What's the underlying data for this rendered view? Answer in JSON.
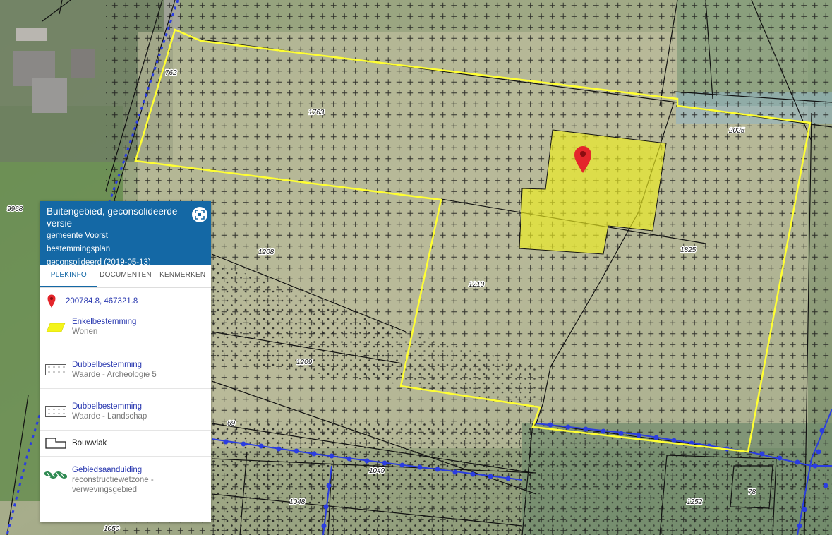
{
  "panel": {
    "title": "Buitengebied, geconsolideerde versie",
    "municipality": "gemeente Voorst",
    "plan_type": "bestemmingsplan",
    "status": "geconsolideerd (2019-05-13)",
    "fullscreen_icon": "fullscreen-icon"
  },
  "tabs": [
    {
      "label": "PLEKINFO",
      "active": true
    },
    {
      "label": "DOCUMENTEN",
      "active": false
    },
    {
      "label": "KENMERKEN",
      "active": false
    }
  ],
  "location": {
    "coordinates": "200784.8, 467321.8",
    "icon": "location-pin-icon"
  },
  "info_items": [
    {
      "title": "Enkelbestemming",
      "subtitle": "Wonen",
      "icon": "yellow-parallelogram-icon"
    },
    {
      "title": "Dubbelbestemming",
      "subtitle": "Waarde - Archeologie 5",
      "icon": "dotted-grid-icon"
    },
    {
      "title": "Dubbelbestemming",
      "subtitle": "Waarde - Landschap",
      "icon": "cross-grid-icon"
    },
    {
      "title": "Bouwvlak",
      "subtitle": "",
      "icon": "building-outline-icon"
    },
    {
      "title": "Gebiedsaanduiding",
      "subtitle": "reconstructiewetzone - verwevingsgebied",
      "icon": "green-hatch-icon"
    }
  ],
  "parcel_labels": [
    "762",
    "1763",
    "2025",
    "9968",
    "1208",
    "1825",
    "1210",
    "1209",
    "69",
    "1049",
    "1048",
    "1252",
    "78",
    "1050"
  ],
  "colors": {
    "panel_header": "#1468a5",
    "link_text": "#2a39b0",
    "plan_boundary": "#ffff33",
    "wonen_fill": "#f0f020",
    "marker": "#e4262b",
    "network_line": "#2b3de0"
  }
}
